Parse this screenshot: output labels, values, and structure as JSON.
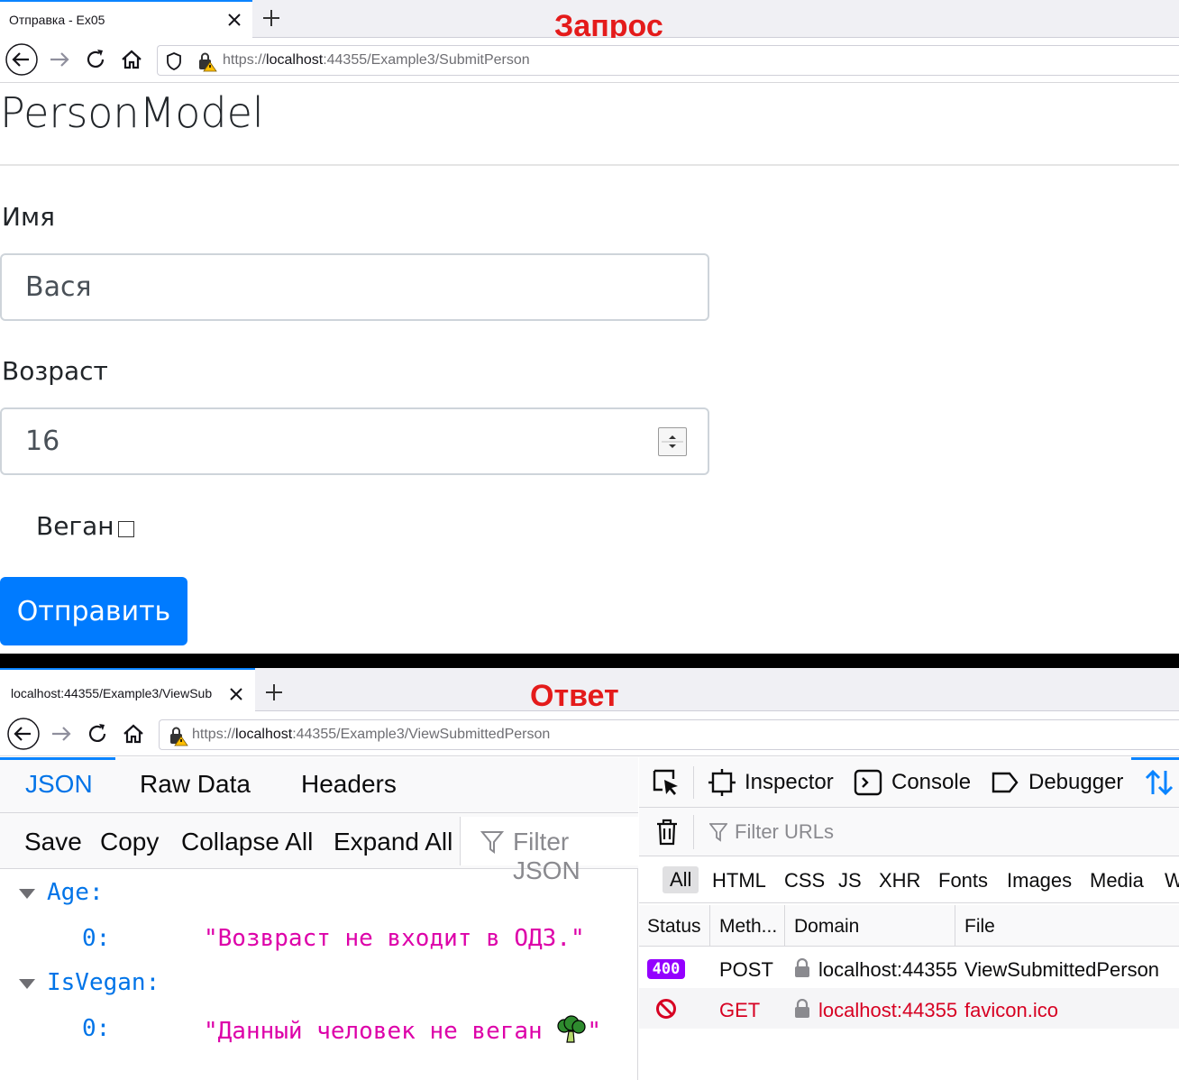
{
  "top_browser": {
    "tab_title": "Отправка - Ex05",
    "caption": "Запрос",
    "url_prefix": "https://",
    "url_host": "localhost",
    "url_rest": ":44355/Example3/SubmitPerson"
  },
  "form": {
    "title": "PersonModel",
    "name_label": "Имя",
    "name_value": "Вася",
    "age_label": "Возраст",
    "age_value": "16",
    "vegan_label": "Веган",
    "vegan_checked": false,
    "submit_label": "Отправить"
  },
  "bottom_browser": {
    "tab_title": "localhost:44355/Example3/ViewSub",
    "caption": "Ответ",
    "url_prefix": "https://",
    "url_host": "localhost",
    "url_rest": ":44355/Example3/ViewSubmittedPerson"
  },
  "json_viewer": {
    "tabs": [
      "JSON",
      "Raw Data",
      "Headers"
    ],
    "toolbar": [
      "Save",
      "Copy",
      "Collapse All",
      "Expand All"
    ],
    "filter_placeholder": "Filter JSON",
    "entries": [
      {
        "key": "Age:",
        "index": "0:",
        "value": "\"Возвраст не входит в ОДЗ.\""
      },
      {
        "key": "IsVegan:",
        "index": "0:",
        "value_text": "\"Данный человек не веган ",
        "value_end": "\""
      }
    ]
  },
  "devtools": {
    "tabs": [
      "Inspector",
      "Console",
      "Debugger"
    ],
    "filter_placeholder": "Filter URLs",
    "types": [
      "All",
      "HTML",
      "CSS",
      "JS",
      "XHR",
      "Fonts",
      "Images",
      "Media",
      "W"
    ],
    "columns": [
      "Status",
      "Meth...",
      "Domain",
      "File"
    ],
    "requests": [
      {
        "status": "400",
        "method": "POST",
        "domain": "localhost:44355",
        "file": "ViewSubmittedPerson"
      },
      {
        "status": "blocked",
        "method": "GET",
        "domain": "localhost:44355",
        "file": "favicon.ico"
      }
    ],
    "colors": {
      "accent": "#0a84ff",
      "error_text": "#d70022",
      "status_400": "#9400ff"
    }
  }
}
